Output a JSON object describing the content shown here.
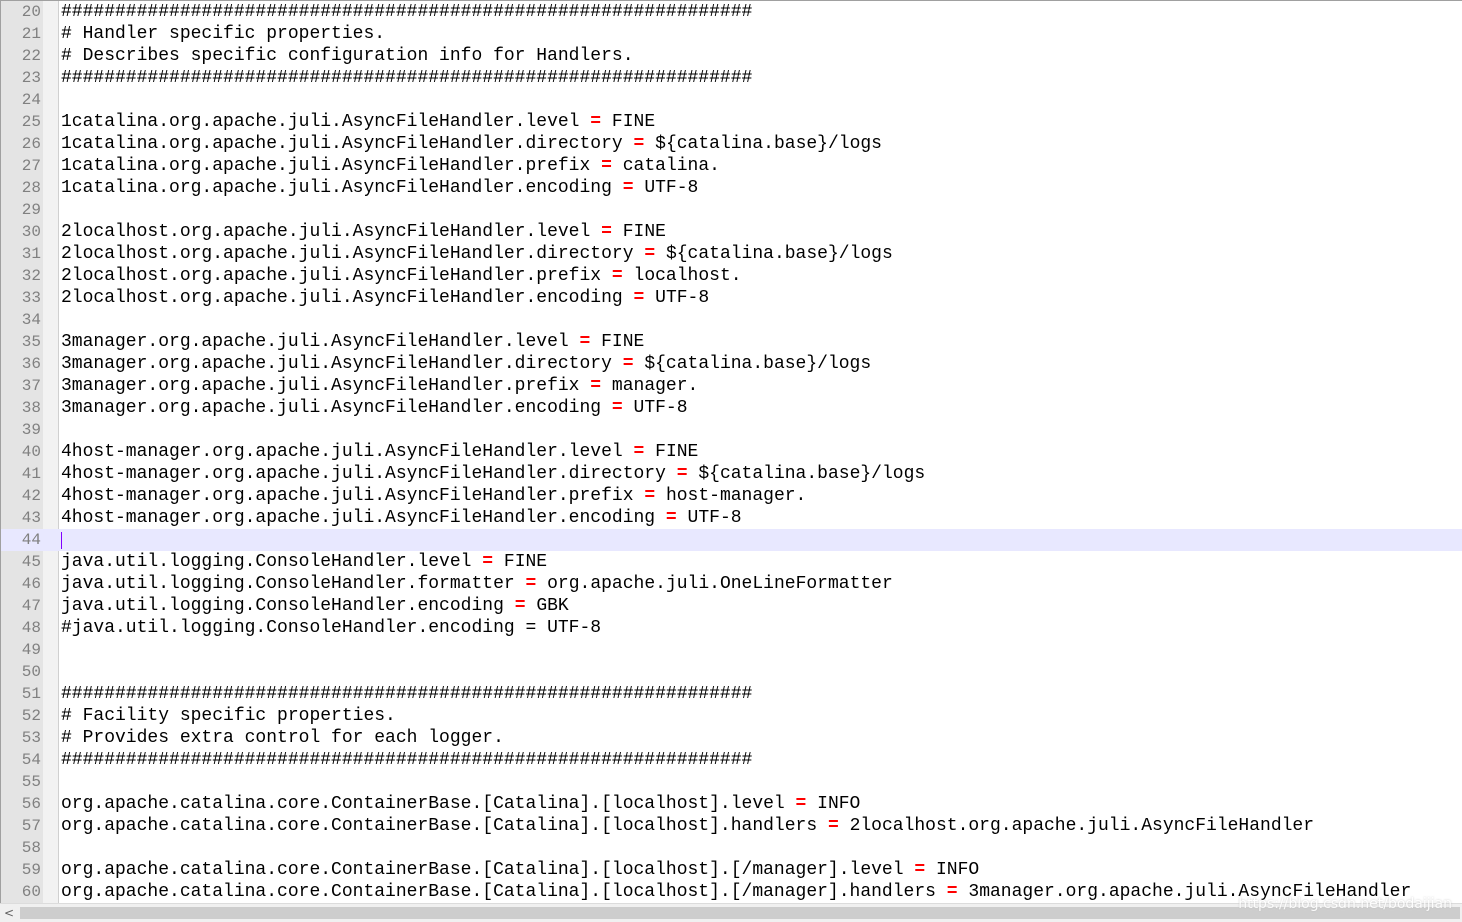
{
  "editor": {
    "current_line": "44",
    "lines": [
      {
        "num": "20",
        "type": "comment",
        "text": "################################################################"
      },
      {
        "num": "21",
        "type": "comment",
        "text": "# Handler specific properties."
      },
      {
        "num": "22",
        "type": "comment",
        "text": "# Describes specific configuration info for Handlers."
      },
      {
        "num": "23",
        "type": "comment",
        "text": "################################################################"
      },
      {
        "num": "24",
        "type": "empty"
      },
      {
        "num": "25",
        "type": "prop",
        "key": "1catalina.org.apache.juli.AsyncFileHandler.level",
        "op": "=",
        "val": "FINE"
      },
      {
        "num": "26",
        "type": "prop",
        "key": "1catalina.org.apache.juli.AsyncFileHandler.directory",
        "op": "=",
        "val": "${catalina.base}/logs"
      },
      {
        "num": "27",
        "type": "prop",
        "key": "1catalina.org.apache.juli.AsyncFileHandler.prefix",
        "op": "=",
        "val": "catalina."
      },
      {
        "num": "28",
        "type": "prop",
        "key": "1catalina.org.apache.juli.AsyncFileHandler.encoding",
        "op": "=",
        "val": "UTF-8"
      },
      {
        "num": "29",
        "type": "empty"
      },
      {
        "num": "30",
        "type": "prop",
        "key": "2localhost.org.apache.juli.AsyncFileHandler.level",
        "op": "=",
        "val": "FINE"
      },
      {
        "num": "31",
        "type": "prop",
        "key": "2localhost.org.apache.juli.AsyncFileHandler.directory",
        "op": "=",
        "val": "${catalina.base}/logs"
      },
      {
        "num": "32",
        "type": "prop",
        "key": "2localhost.org.apache.juli.AsyncFileHandler.prefix",
        "op": "=",
        "val": "localhost."
      },
      {
        "num": "33",
        "type": "prop",
        "key": "2localhost.org.apache.juli.AsyncFileHandler.encoding",
        "op": "=",
        "val": "UTF-8"
      },
      {
        "num": "34",
        "type": "empty"
      },
      {
        "num": "35",
        "type": "prop",
        "key": "3manager.org.apache.juli.AsyncFileHandler.level",
        "op": "=",
        "val": "FINE"
      },
      {
        "num": "36",
        "type": "prop",
        "key": "3manager.org.apache.juli.AsyncFileHandler.directory",
        "op": "=",
        "val": "${catalina.base}/logs"
      },
      {
        "num": "37",
        "type": "prop",
        "key": "3manager.org.apache.juli.AsyncFileHandler.prefix",
        "op": "=",
        "val": "manager."
      },
      {
        "num": "38",
        "type": "prop",
        "key": "3manager.org.apache.juli.AsyncFileHandler.encoding",
        "op": "=",
        "val": "UTF-8"
      },
      {
        "num": "39",
        "type": "empty"
      },
      {
        "num": "40",
        "type": "prop",
        "key": "4host-manager.org.apache.juli.AsyncFileHandler.level",
        "op": "=",
        "val": "FINE"
      },
      {
        "num": "41",
        "type": "prop",
        "key": "4host-manager.org.apache.juli.AsyncFileHandler.directory",
        "op": "=",
        "val": "${catalina.base}/logs"
      },
      {
        "num": "42",
        "type": "prop",
        "key": "4host-manager.org.apache.juli.AsyncFileHandler.prefix",
        "op": "=",
        "val": "host-manager."
      },
      {
        "num": "43",
        "type": "prop",
        "key": "4host-manager.org.apache.juli.AsyncFileHandler.encoding",
        "op": "=",
        "val": "UTF-8"
      },
      {
        "num": "44",
        "type": "empty"
      },
      {
        "num": "45",
        "type": "prop",
        "key": "java.util.logging.ConsoleHandler.level",
        "op": "=",
        "val": "FINE"
      },
      {
        "num": "46",
        "type": "prop",
        "key": "java.util.logging.ConsoleHandler.formatter",
        "op": "=",
        "val": "org.apache.juli.OneLineFormatter"
      },
      {
        "num": "47",
        "type": "prop",
        "key": "java.util.logging.ConsoleHandler.encoding",
        "op": "=",
        "val": "GBK"
      },
      {
        "num": "48",
        "type": "comment",
        "text": "#java.util.logging.ConsoleHandler.encoding = UTF-8"
      },
      {
        "num": "49",
        "type": "empty"
      },
      {
        "num": "50",
        "type": "empty"
      },
      {
        "num": "51",
        "type": "comment",
        "text": "################################################################"
      },
      {
        "num": "52",
        "type": "comment",
        "text": "# Facility specific properties."
      },
      {
        "num": "53",
        "type": "comment",
        "text": "# Provides extra control for each logger."
      },
      {
        "num": "54",
        "type": "comment",
        "text": "################################################################"
      },
      {
        "num": "55",
        "type": "empty"
      },
      {
        "num": "56",
        "type": "prop",
        "key": "org.apache.catalina.core.ContainerBase.[Catalina].[localhost].level",
        "op": "=",
        "val": "INFO"
      },
      {
        "num": "57",
        "type": "prop",
        "key": "org.apache.catalina.core.ContainerBase.[Catalina].[localhost].handlers",
        "op": "=",
        "val": "2localhost.org.apache.juli.AsyncFileHandler"
      },
      {
        "num": "58",
        "type": "empty"
      },
      {
        "num": "59",
        "type": "prop",
        "key": "org.apache.catalina.core.ContainerBase.[Catalina].[localhost].[/manager].level",
        "op": "=",
        "val": "INFO"
      },
      {
        "num": "60",
        "type": "prop",
        "key": "org.apache.catalina.core.ContainerBase.[Catalina].[localhost].[/manager].handlers",
        "op": "=",
        "val": "3manager.org.apache.juli.AsyncFileHandler"
      }
    ]
  },
  "scrollbar": {
    "left_arrow": "<"
  },
  "watermark": "https://blog.csdn.net/bodaijian",
  "colors": {
    "comment": "#008000",
    "operator": "#ff0000",
    "line_number": "#808080",
    "current_line_bg": "#e8e8ff",
    "gutter_bg": "#e4e4e4"
  }
}
